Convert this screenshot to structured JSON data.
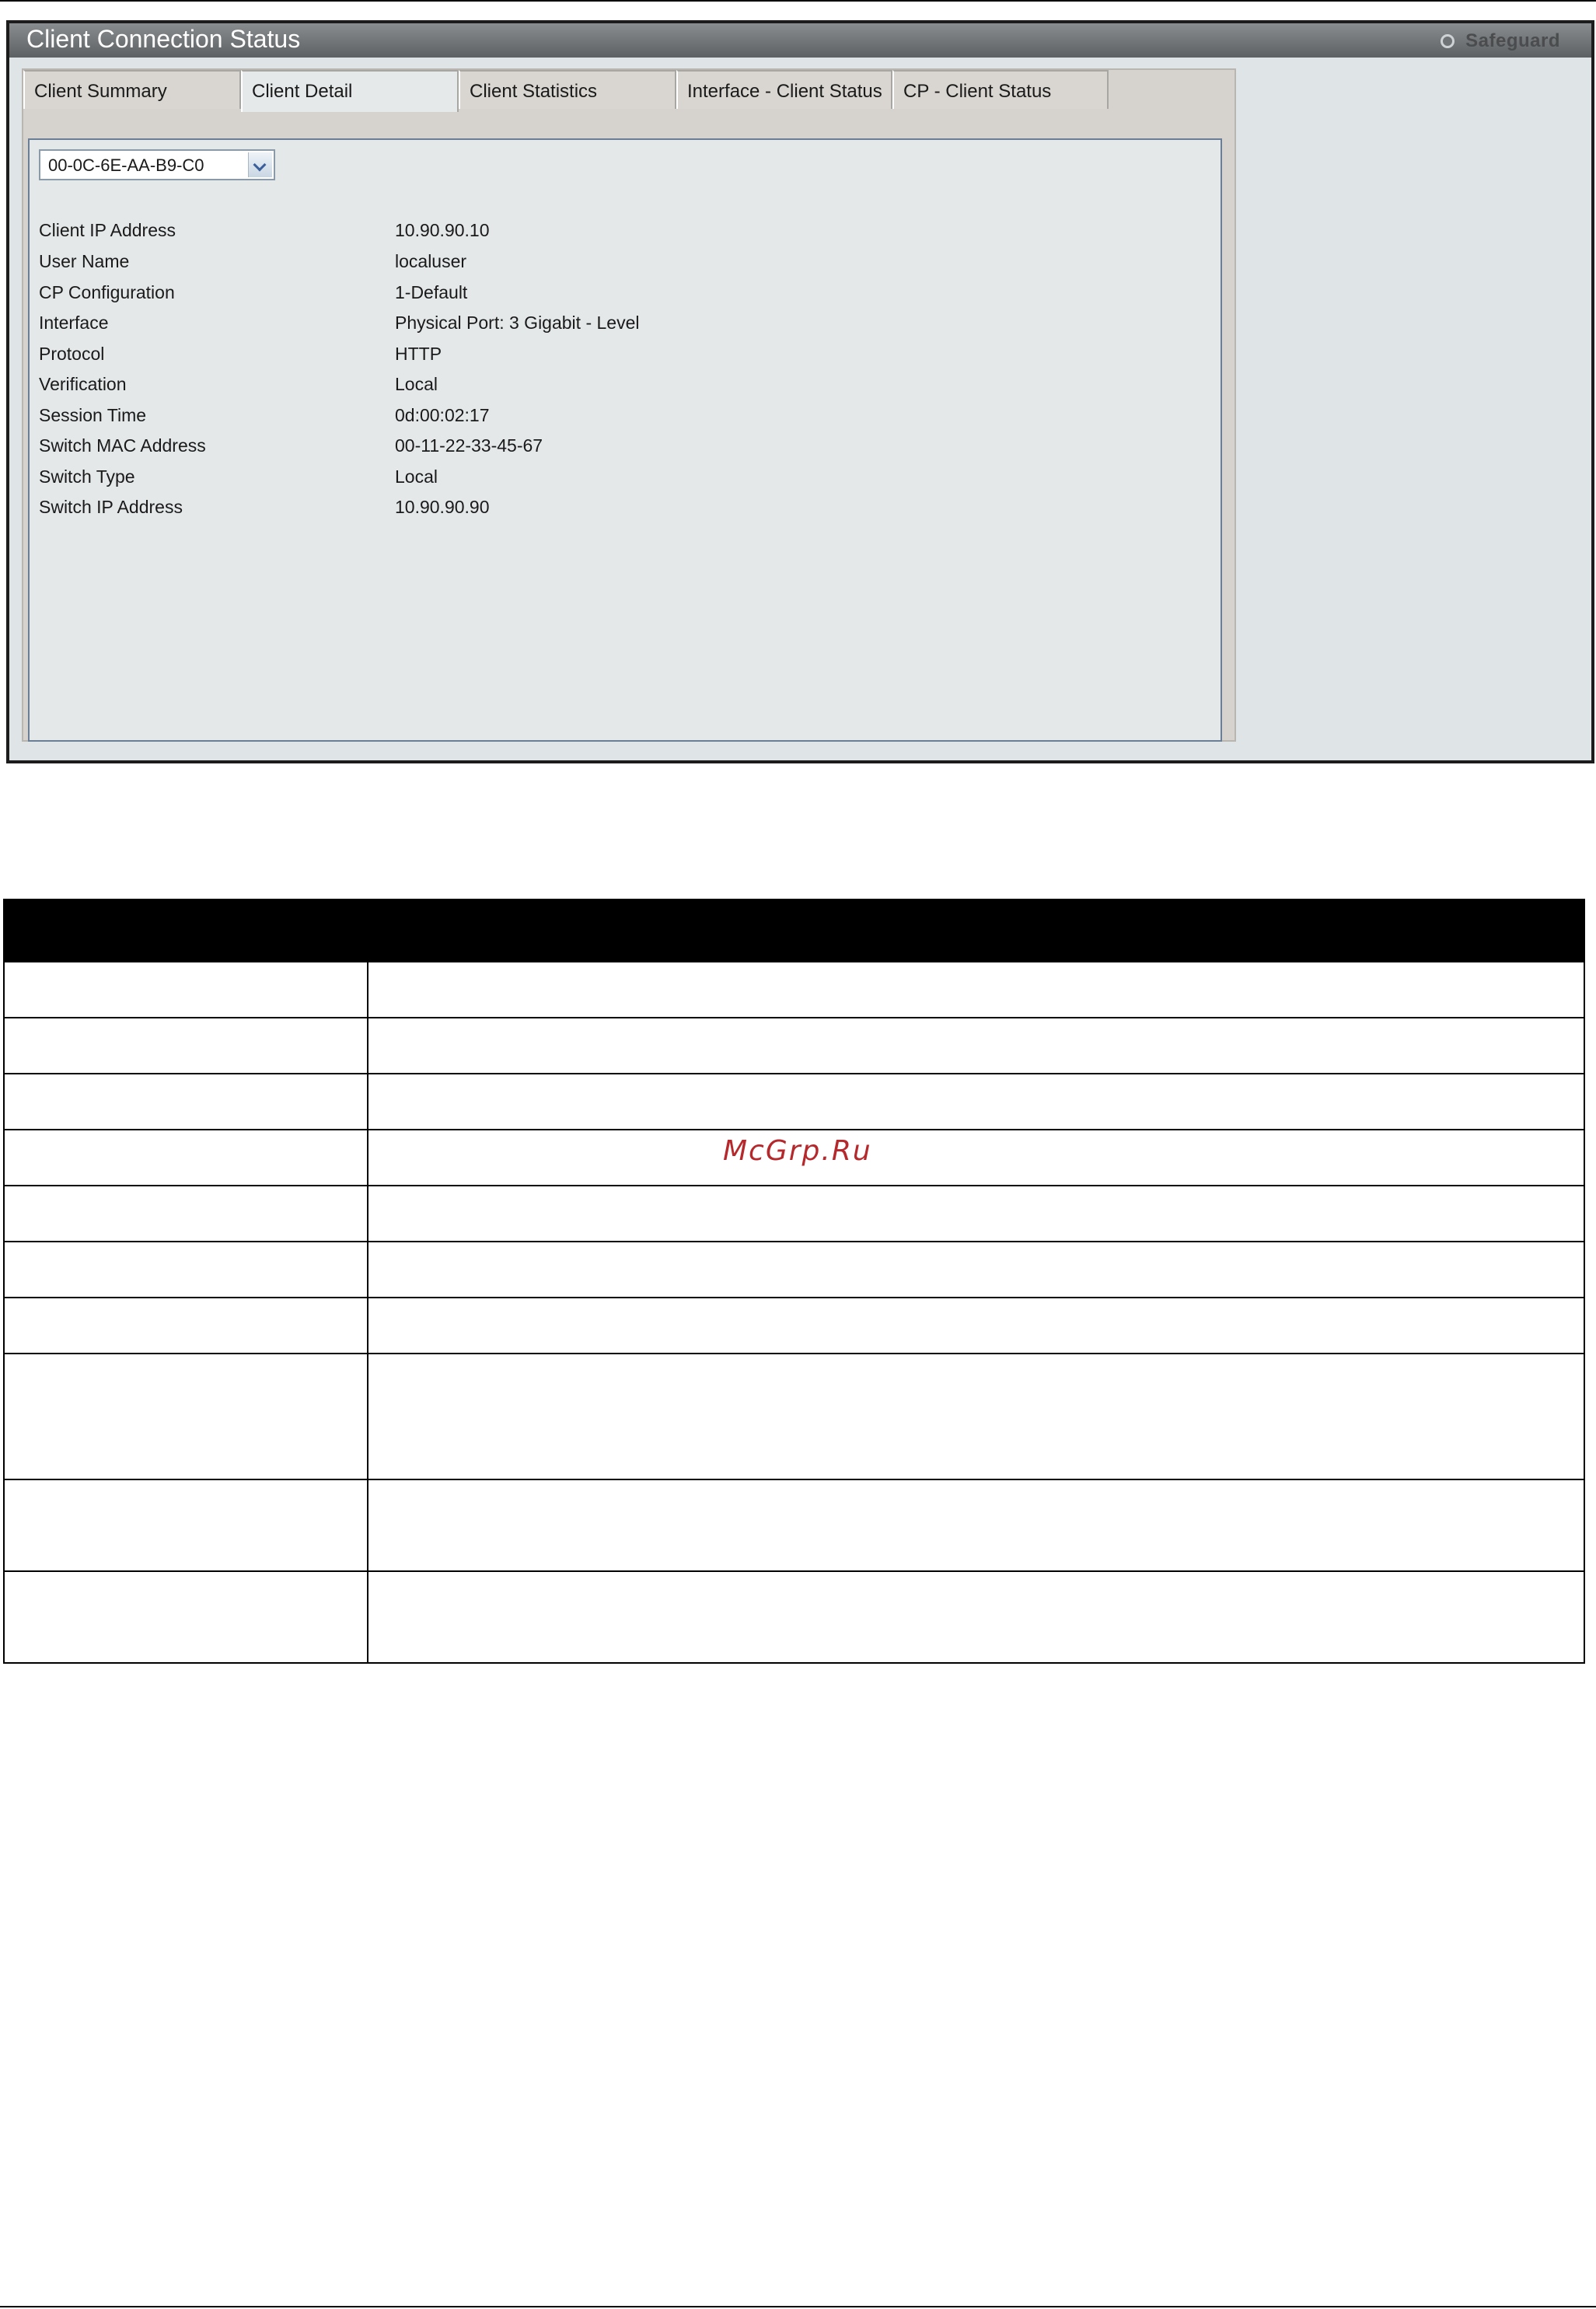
{
  "window": {
    "title": "Client Connection Status",
    "safeguard_label": "Safeguard"
  },
  "tabs": [
    {
      "label": "Client Summary",
      "active": false
    },
    {
      "label": "Client Detail",
      "active": true
    },
    {
      "label": "Client Statistics",
      "active": false
    },
    {
      "label": "Interface - Client Status",
      "active": false
    },
    {
      "label": "CP - Client Status",
      "active": false
    }
  ],
  "client_select": {
    "value": "00-0C-6E-AA-B9-C0"
  },
  "details": [
    {
      "label": "Client IP Address",
      "value": "10.90.90.10"
    },
    {
      "label": "User Name",
      "value": "localuser"
    },
    {
      "label": "CP Configuration",
      "value": "1-Default"
    },
    {
      "label": "Interface",
      "value": "Physical Port: 3 Gigabit - Level"
    },
    {
      "label": "Protocol",
      "value": "HTTP"
    },
    {
      "label": "Verification",
      "value": "Local"
    },
    {
      "label": "Session Time",
      "value": "0d:00:02:17"
    },
    {
      "label": "Switch MAC Address",
      "value": "00-11-22-33-45-67"
    },
    {
      "label": "Switch Type",
      "value": "Local"
    },
    {
      "label": "Switch IP Address",
      "value": "10.90.90.90"
    }
  ],
  "watermark": "McGrp.Ru"
}
